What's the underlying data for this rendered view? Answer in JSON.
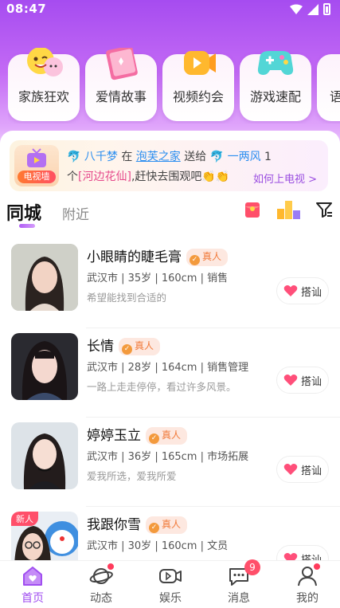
{
  "status": {
    "time": "08:47"
  },
  "categories": [
    {
      "label": "家族狂欢",
      "icon": "emoji-faces-icon"
    },
    {
      "label": "爱情故事",
      "icon": "pink-book-icon"
    },
    {
      "label": "视频约会",
      "icon": "video-camera-icon"
    },
    {
      "label": "游戏速配",
      "icon": "gamepad-icon"
    },
    {
      "label": "语",
      "icon": "voice-icon"
    }
  ],
  "ticker": {
    "badge": "电视墙",
    "user1": "八千梦",
    "at": "在",
    "house": "泡芙之家",
    "gave": "送给",
    "user2": "一两风",
    "count": "1",
    "line2_prefix": "个",
    "gift": "[河边花仙]",
    "line2_suffix": ",赶快去围观吧👏👏",
    "how": "如何上电视 >"
  },
  "tabs": {
    "active": "同城",
    "inactive": "附近"
  },
  "users": [
    {
      "name": "小眼睛的睫毛膏",
      "verified": "真人",
      "meta": "武汉市 | 35岁 | 160cm | 销售",
      "motto": "希望能找到合适的",
      "action": "搭讪",
      "new": ""
    },
    {
      "name": "长情",
      "verified": "真人",
      "meta": "武汉市 | 28岁 | 164cm | 销售管理",
      "motto": "一路上走走停停，看过许多风景。",
      "action": "搭讪",
      "new": ""
    },
    {
      "name": "婷婷玉立",
      "verified": "真人",
      "meta": "武汉市 | 36岁 | 165cm | 市场拓展",
      "motto": "爱我所选，爱我所爱",
      "action": "搭讪",
      "new": ""
    },
    {
      "name": "我跟你雪",
      "verified": "真人",
      "meta": "武汉市 | 30岁 | 160cm | 文员",
      "motto": "",
      "action": "搭讪",
      "new": "新人"
    }
  ],
  "nav": [
    {
      "label": "首页",
      "icon": "home-icon"
    },
    {
      "label": "动态",
      "icon": "planet-icon"
    },
    {
      "label": "娱乐",
      "icon": "video-icon"
    },
    {
      "label": "消息",
      "icon": "message-icon",
      "badge": "9"
    },
    {
      "label": "我的",
      "icon": "profile-icon"
    }
  ],
  "colors": {
    "accent": "#a04ef0",
    "header_top": "#a64cf0",
    "badge": "#ff4f6a"
  }
}
